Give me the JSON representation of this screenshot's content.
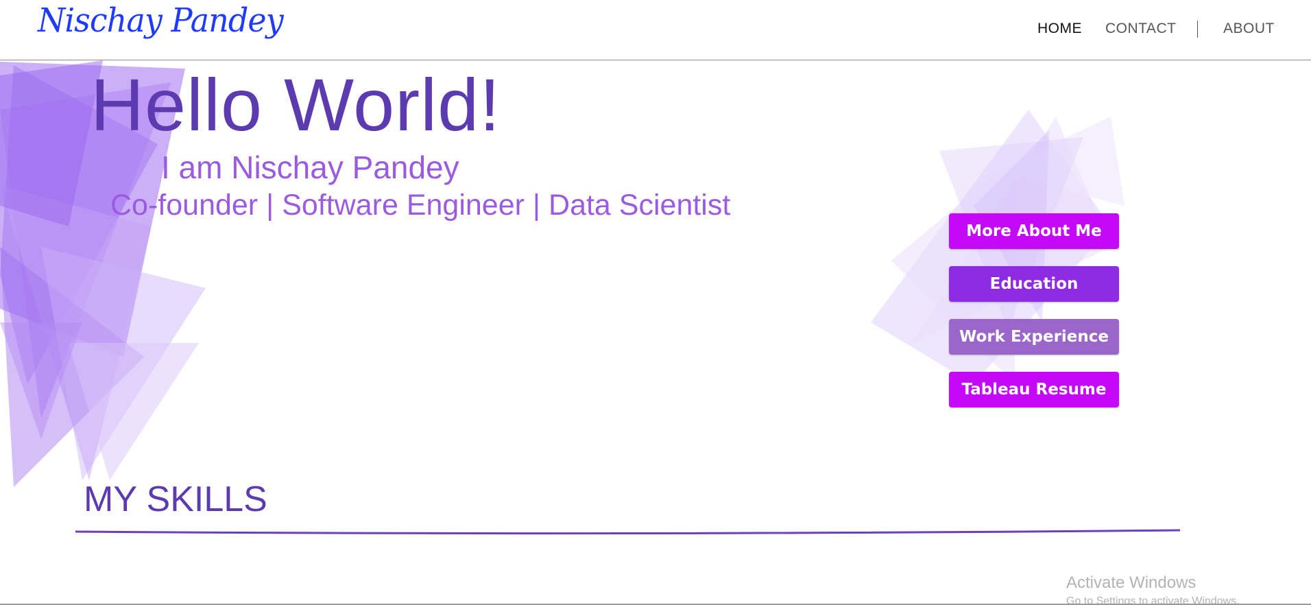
{
  "header": {
    "brand": "Nischay Pandey",
    "nav": {
      "home": "HOME",
      "contact": "CONTACT",
      "about": "ABOUT"
    }
  },
  "hero": {
    "title": "Hello World!",
    "name_line": "I am Nischay Pandey",
    "roles_line": "Co-founder | Software Engineer | Data Scientist"
  },
  "buttons": [
    {
      "label": "More About Me",
      "color": "#c409f7"
    },
    {
      "label": "Education",
      "color": "#8c2be2"
    },
    {
      "label": "Work Experience",
      "color": "#9a66c9"
    },
    {
      "label": "Tableau Resume",
      "color": "#c409f7"
    }
  ],
  "skills": {
    "title": "MY SKILLS"
  },
  "watermark": {
    "title": "Activate Windows",
    "subtitle": "Go to Settings to activate Windows."
  },
  "theme": {
    "primary_purple": "#5c3bb0",
    "light_purple": "#9b5be0",
    "brand_blue": "#1f3bff",
    "shape_purple": "#a77cf0"
  }
}
